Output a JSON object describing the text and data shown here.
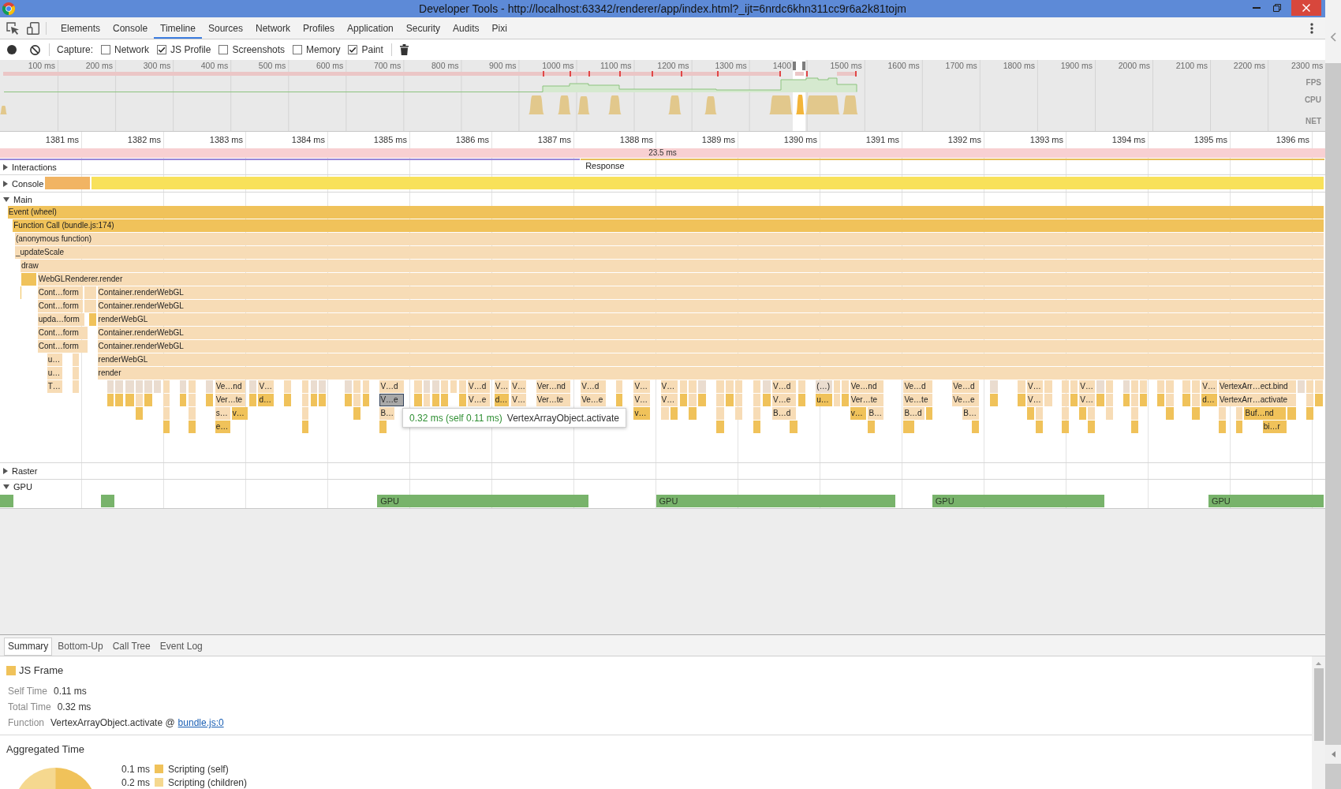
{
  "window": {
    "title": "Developer Tools - http://localhost:63342/renderer/app/index.html?_ijt=6nrdc6khn311cc9r6a2k81tojm"
  },
  "tabs": [
    {
      "label": "Elements",
      "selected": false
    },
    {
      "label": "Console",
      "selected": false
    },
    {
      "label": "Timeline",
      "selected": true
    },
    {
      "label": "Sources",
      "selected": false
    },
    {
      "label": "Network",
      "selected": false
    },
    {
      "label": "Profiles",
      "selected": false
    },
    {
      "label": "Application",
      "selected": false
    },
    {
      "label": "Security",
      "selected": false
    },
    {
      "label": "Audits",
      "selected": false
    },
    {
      "label": "Pixi",
      "selected": false
    }
  ],
  "toolbar": {
    "capture_label": "Capture:",
    "options": [
      {
        "label": "Network",
        "checked": false
      },
      {
        "label": "JS Profile",
        "checked": true
      },
      {
        "label": "Screenshots",
        "checked": false
      },
      {
        "label": "Memory",
        "checked": false
      },
      {
        "label": "Paint",
        "checked": true
      }
    ]
  },
  "overview": {
    "ticks": [
      "100 ms",
      "200 ms",
      "300 ms",
      "400 ms",
      "500 ms",
      "600 ms",
      "700 ms",
      "800 ms",
      "900 ms",
      "1000 ms",
      "1100 ms",
      "1200 ms",
      "1300 ms",
      "1400",
      "1500 ms",
      "1600 ms",
      "1700 ms",
      "1800 ms",
      "1900 ms",
      "2000 ms",
      "2100 ms",
      "2200 ms",
      "2300 ms"
    ],
    "lanes": [
      "FPS",
      "CPU",
      "NET"
    ]
  },
  "ruler": {
    "ticks": [
      "1381 ms",
      "1382 ms",
      "1383 ms",
      "1384 ms",
      "1385 ms",
      "1386 ms",
      "1387 ms",
      "1388 ms",
      "1389 ms",
      "1390 ms",
      "1391 ms",
      "1392 ms",
      "1393 ms",
      "1394 ms",
      "1395 ms",
      "1396 ms"
    ]
  },
  "frame": {
    "duration": "23.5 ms"
  },
  "tracks": [
    {
      "name": "Interactions",
      "kind": "interactions",
      "expanded": false,
      "rows": [
        {
          "blocks": [
            {
              "color": "#9a88d8",
              "selected": false
            },
            {
              "label": "Response",
              "color": "#e6bf5a",
              "selected": false
            }
          ]
        }
      ]
    },
    {
      "name": "Console",
      "kind": "console",
      "expanded": false,
      "rows": [
        {
          "blocks": [
            {
              "color": "#f1b463",
              "selected": false
            },
            {
              "color": "#f8e15a",
              "selected": false
            }
          ]
        }
      ]
    },
    {
      "name": "Main",
      "kind": "flame",
      "expanded": true,
      "rows": [
        {
          "blocks": [
            {
              "label": "Event (wheel)",
              "color": "#f0c25a",
              "selected": false
            }
          ]
        },
        {
          "blocks": [
            {
              "label": "Function Call (bundle.js:174)",
              "color": "#f0c25a",
              "selected": false
            }
          ]
        },
        {
          "blocks": [
            {
              "label": "(anonymous function)",
              "color": "#f7dcb6",
              "selected": false
            }
          ]
        },
        {
          "blocks": [
            {
              "label": "_updateScale",
              "color": "#f7dcb6",
              "selected": false
            }
          ]
        },
        {
          "blocks": [
            {
              "label": "draw",
              "color": "#f7dcb6",
              "selected": false
            }
          ]
        },
        {
          "blocks": [
            {
              "color": "#f0c25a",
              "selected": false
            },
            {
              "label": "WebGLRenderer.render",
              "color": "#f7dcb6",
              "selected": false
            }
          ]
        },
        {
          "blocks": [
            {
              "color": "#f0c25a",
              "selected": false
            },
            {
              "label": "Cont…form",
              "color": "#f7dcb6",
              "selected": false
            },
            {
              "color": "#f7dcb6",
              "selected": false
            },
            {
              "label": "Container.renderWebGL",
              "color": "#f7dcb6",
              "selected": false
            }
          ]
        },
        {
          "blocks": [
            {
              "label": "Cont…form",
              "color": "#f7dcb6",
              "selected": false
            },
            {
              "color": "#f7dcb6",
              "selected": false
            },
            {
              "label": "Container.renderWebGL",
              "color": "#f7dcb6",
              "selected": false
            }
          ]
        },
        {
          "blocks": [
            {
              "label": "upda…form",
              "color": "#f7dcb6",
              "selected": false
            },
            {
              "color": "#f0c25a",
              "selected": false
            },
            {
              "label": "renderWebGL",
              "color": "#f7dcb6",
              "selected": false
            }
          ]
        },
        {
          "blocks": [
            {
              "label": "Cont…form",
              "color": "#f7dcb6",
              "selected": false
            },
            {
              "label": "Container.renderWebGL",
              "color": "#f7dcb6",
              "selected": false
            }
          ]
        },
        {
          "blocks": [
            {
              "label": "Cont…form",
              "color": "#f7dcb6",
              "selected": false
            },
            {
              "label": "Container.renderWebGL",
              "color": "#f7dcb6",
              "selected": false
            }
          ]
        },
        {
          "blocks": [
            {
              "label": "u…",
              "color": "#f7dcb6",
              "selected": false
            },
            {
              "color": "#f7dcb6",
              "selected": false
            },
            {
              "label": "renderWebGL",
              "color": "#f7dcb6",
              "selected": false
            }
          ]
        },
        {
          "blocks": [
            {
              "label": "u…",
              "color": "#f7dcb6",
              "selected": false
            },
            {
              "color": "#f7dcb6",
              "selected": false
            },
            {
              "label": "render",
              "color": "#f7dcb6",
              "selected": false
            }
          ]
        },
        {
          "blocks": [
            {
              "label": "T…",
              "color": "#f7dcb6",
              "selected": false
            },
            {
              "color": "#f7dcb6",
              "selected": false
            },
            {
              "color": "#eadccf",
              "selected": false
            },
            {
              "color": "#eadccf",
              "selected": false
            },
            {
              "color": "#eadccf",
              "selected": false
            },
            {
              "color": "#eadccf",
              "selected": false
            },
            {
              "color": "#eadccf",
              "selected": false
            },
            {
              "color": "#eadccf",
              "selected": false
            },
            {
              "color": "#f7dcb6",
              "selected": false
            },
            {
              "color": "#eadccf",
              "selected": false
            },
            {
              "color": "#f7dcb6",
              "selected": false
            },
            {
              "color": "#eadccf",
              "selected": false
            },
            {
              "label": "Ve…nd",
              "color": "#f7dcb6",
              "selected": false
            },
            {
              "color": "#eadccf",
              "selected": false
            },
            {
              "label": "V…",
              "color": "#f7dcb6",
              "selected": false
            },
            {
              "color": "#f7dcb6",
              "selected": false
            },
            {
              "color": "#f7dcb6",
              "selected": false
            },
            {
              "color": "#eadccf",
              "selected": false
            },
            {
              "color": "#eadccf",
              "selected": false
            },
            {
              "color": "#eadccf",
              "selected": false
            },
            {
              "color": "#f7dcb6",
              "selected": false
            },
            {
              "color": "#f7dcb6",
              "selected": false
            },
            {
              "label": "V…d",
              "color": "#f7dcb6",
              "selected": false
            },
            {
              "color": "#f7dcb6",
              "selected": false
            },
            {
              "color": "#eadccf",
              "selected": false
            },
            {
              "color": "#eadccf",
              "selected": false
            },
            {
              "color": "#f7dcb6",
              "selected": false
            },
            {
              "color": "#f7dcb6",
              "selected": false
            },
            {
              "color": "#f7dcb6",
              "selected": false
            },
            {
              "label": "V…d",
              "color": "#f7dcb6",
              "selected": false
            },
            {
              "label": "V…",
              "color": "#f7dcb6",
              "selected": false
            },
            {
              "label": "V…",
              "color": "#f7dcb6",
              "selected": false
            },
            {
              "label": "Ver…nd",
              "color": "#f7dcb6",
              "selected": false
            },
            {
              "label": "V…d",
              "color": "#f7dcb6",
              "selected": false
            },
            {
              "color": "#f7dcb6",
              "selected": false
            },
            {
              "label": "V…",
              "color": "#f7dcb6",
              "selected": false
            },
            {
              "label": "V…",
              "color": "#f7dcb6",
              "selected": false
            },
            {
              "color": "#f7dcb6",
              "selected": false
            },
            {
              "color": "#f7dcb6",
              "selected": false
            },
            {
              "color": "#eadccf",
              "selected": false
            },
            {
              "color": "#f7dcb6",
              "selected": false
            },
            {
              "color": "#f7dcb6",
              "selected": false
            },
            {
              "color": "#f7dcb6",
              "selected": false
            },
            {
              "color": "#f7dcb6",
              "selected": false
            },
            {
              "color": "#eadccf",
              "selected": false
            },
            {
              "label": "V…d",
              "color": "#f7dcb6",
              "selected": false
            },
            {
              "color": "#f7dcb6",
              "selected": false
            },
            {
              "label": "(…)",
              "color": "#eadccf",
              "selected": false
            },
            {
              "color": "#f7dcb6",
              "selected": false
            },
            {
              "color": "#f7dcb6",
              "selected": false
            },
            {
              "label": "Ve…nd",
              "color": "#f7dcb6",
              "selected": false
            },
            {
              "label": "Ve…d",
              "color": "#f7dcb6",
              "selected": false
            },
            {
              "label": "Ve…d",
              "color": "#f7dcb6",
              "selected": false
            },
            {
              "color": "#eadccf",
              "selected": false
            },
            {
              "color": "#f7dcb6",
              "selected": false
            },
            {
              "label": "V…",
              "color": "#f7dcb6",
              "selected": false
            },
            {
              "color": "#f7dcb6",
              "selected": false
            },
            {
              "color": "#f7dcb6",
              "selected": false
            },
            {
              "color": "#f7dcb6",
              "selected": false
            },
            {
              "label": "V…",
              "color": "#f7dcb6",
              "selected": false
            },
            {
              "color": "#eadccf",
              "selected": false
            },
            {
              "color": "#f7dcb6",
              "selected": false
            },
            {
              "color": "#eadccf",
              "selected": false
            },
            {
              "color": "#f7dcb6",
              "selected": false
            },
            {
              "color": "#f7dcb6",
              "selected": false
            },
            {
              "color": "#f7dcb6",
              "selected": false
            },
            {
              "color": "#f7dcb6",
              "selected": false
            },
            {
              "color": "#f7dcb6",
              "selected": false
            },
            {
              "color": "#f7dcb6",
              "selected": false
            },
            {
              "label": "V…",
              "color": "#f7dcb6",
              "selected": false
            },
            {
              "label": "VertexArr…ect.bind",
              "color": "#f7dcb6",
              "selected": false
            },
            {
              "color": "#eadccf",
              "selected": false
            },
            {
              "color": "#f7dcb6",
              "selected": false
            },
            {
              "color": "#f7dcb6",
              "selected": false
            }
          ]
        },
        {
          "blocks": [
            {
              "color": "#f0c25a",
              "selected": false
            },
            {
              "color": "#f0c25a",
              "selected": false
            },
            {
              "color": "#f0c25a",
              "selected": false
            },
            {
              "color": "#f7dcb6",
              "selected": false
            },
            {
              "color": "#f0c25a",
              "selected": false
            },
            {
              "color": "#f7dcb6",
              "selected": false
            },
            {
              "color": "#f0c25a",
              "selected": false
            },
            {
              "color": "#f7dcb6",
              "selected": false
            },
            {
              "color": "#f0c25a",
              "selected": false
            },
            {
              "label": "Ver…te",
              "color": "#f7dcb6",
              "selected": false
            },
            {
              "color": "#f0c25a",
              "selected": false
            },
            {
              "label": "d…",
              "color": "#f0c25a",
              "selected": false
            },
            {
              "color": "#f0c25a",
              "selected": false
            },
            {
              "color": "#f7dcb6",
              "selected": false
            },
            {
              "color": "#f0c25a",
              "selected": false
            },
            {
              "color": "#f0c25a",
              "selected": false
            },
            {
              "color": "#f0c25a",
              "selected": false
            },
            {
              "color": "#f7dcb6",
              "selected": false
            },
            {
              "color": "#f0c25a",
              "selected": false
            },
            {
              "label": "V…e",
              "selected": true
            },
            {
              "color": "#f0c25a",
              "selected": false
            },
            {
              "color": "#f7dcb6",
              "selected": false
            },
            {
              "color": "#f0c25a",
              "selected": false
            },
            {
              "color": "#f0c25a",
              "selected": false
            },
            {
              "color": "#f0c25a",
              "selected": false
            },
            {
              "label": "V…e",
              "color": "#f7dcb6",
              "selected": false
            },
            {
              "label": "d…",
              "color": "#f0c25a",
              "selected": false
            },
            {
              "label": "V…",
              "color": "#f7dcb6",
              "selected": false
            },
            {
              "label": "Ver…te",
              "color": "#f7dcb6",
              "selected": false
            },
            {
              "label": "Ve…e",
              "color": "#f7dcb6",
              "selected": false
            },
            {
              "color": "#f0c25a",
              "selected": false
            },
            {
              "label": "V…",
              "color": "#f7dcb6",
              "selected": false
            },
            {
              "label": "V…",
              "color": "#f7dcb6",
              "selected": false
            },
            {
              "color": "#f0c25a",
              "selected": false
            },
            {
              "color": "#f7dcb6",
              "selected": false
            },
            {
              "color": "#f0c25a",
              "selected": false
            },
            {
              "color": "#f7dcb6",
              "selected": false
            },
            {
              "color": "#f0c25a",
              "selected": false
            },
            {
              "color": "#f7dcb6",
              "selected": false
            },
            {
              "color": "#f7dcb6",
              "selected": false
            },
            {
              "color": "#f0c25a",
              "selected": false
            },
            {
              "label": "V…e",
              "color": "#f7dcb6",
              "selected": false
            },
            {
              "color": "#f0c25a",
              "selected": false
            },
            {
              "label": "u…",
              "color": "#f0c25a",
              "selected": false
            },
            {
              "color": "#f7dcb6",
              "selected": false
            },
            {
              "color": "#f0c25a",
              "selected": false
            },
            {
              "label": "Ver…te",
              "color": "#f7dcb6",
              "selected": false
            },
            {
              "label": "Ve…te",
              "color": "#f7dcb6",
              "selected": false
            },
            {
              "label": "Ve…e",
              "color": "#f7dcb6",
              "selected": false
            },
            {
              "color": "#f0c25a",
              "selected": false
            },
            {
              "color": "#f0c25a",
              "selected": false
            },
            {
              "label": "V…",
              "color": "#f7dcb6",
              "selected": false
            },
            {
              "color": "#f7dcb6",
              "selected": false
            },
            {
              "color": "#f7dcb6",
              "selected": false
            },
            {
              "color": "#f0c25a",
              "selected": false
            },
            {
              "label": "V…",
              "color": "#f7dcb6",
              "selected": false
            },
            {
              "color": "#f0c25a",
              "selected": false
            },
            {
              "color": "#f7dcb6",
              "selected": false
            },
            {
              "color": "#f0c25a",
              "selected": false
            },
            {
              "color": "#f7dcb6",
              "selected": false
            },
            {
              "color": "#f0c25a",
              "selected": false
            },
            {
              "color": "#f0c25a",
              "selected": false
            },
            {
              "color": "#f7dcb6",
              "selected": false
            },
            {
              "color": "#f0c25a",
              "selected": false
            },
            {
              "color": "#f7dcb6",
              "selected": false
            },
            {
              "label": "d…",
              "color": "#f0c25a",
              "selected": false
            },
            {
              "label": "VertexArr…activate",
              "color": "#f7dcb6",
              "selected": false
            },
            {
              "color": "#f7dcb6",
              "selected": false
            },
            {
              "color": "#f0c25a",
              "selected": false
            }
          ]
        },
        {
          "blocks": [
            {
              "color": "#f0c25a",
              "selected": false
            },
            {
              "color": "#f7dcb6",
              "selected": false
            },
            {
              "color": "#f7dcb6",
              "selected": false
            },
            {
              "label": "s…",
              "color": "#f7dcb6",
              "selected": false
            },
            {
              "label": "v…",
              "color": "#f0c25a",
              "selected": false
            },
            {
              "color": "#f7dcb6",
              "selected": false
            },
            {
              "color": "#f0c25a",
              "selected": false
            },
            {
              "label": "B…",
              "color": "#f7dcb6",
              "selected": false
            },
            {
              "label": "v…",
              "color": "#f0c25a",
              "selected": false
            },
            {
              "color": "#f7dcb6",
              "selected": false
            },
            {
              "color": "#f0c25a",
              "selected": false
            },
            {
              "color": "#f0c25a",
              "selected": false
            },
            {
              "color": "#f7dcb6",
              "selected": false
            },
            {
              "color": "#f7dcb6",
              "selected": false
            },
            {
              "color": "#f7dcb6",
              "selected": false
            },
            {
              "label": "B…d",
              "color": "#f7dcb6",
              "selected": false
            },
            {
              "label": "v…",
              "color": "#f0c25a",
              "selected": false
            },
            {
              "label": "B…",
              "color": "#f7dcb6",
              "selected": false
            },
            {
              "label": "B…d",
              "color": "#f7dcb6",
              "selected": false
            },
            {
              "color": "#f0c25a",
              "selected": false
            },
            {
              "label": "B…",
              "color": "#f7dcb6",
              "selected": false
            },
            {
              "color": "#f0c25a",
              "selected": false
            },
            {
              "color": "#f7dcb6",
              "selected": false
            },
            {
              "color": "#f7dcb6",
              "selected": false
            },
            {
              "color": "#f0c25a",
              "selected": false
            },
            {
              "color": "#f7dcb6",
              "selected": false
            },
            {
              "color": "#f7dcb6",
              "selected": false
            },
            {
              "color": "#f7dcb6",
              "selected": false
            },
            {
              "color": "#f0c25a",
              "selected": false
            },
            {
              "color": "#f0c25a",
              "selected": false
            },
            {
              "color": "#f7dcb6",
              "selected": false
            },
            {
              "color": "#f7dcb6",
              "selected": false
            },
            {
              "label": "Buf…nd",
              "color": "#f0c25a",
              "selected": false
            },
            {
              "color": "#f0c25a",
              "selected": false
            },
            {
              "color": "#f0c25a",
              "selected": false
            }
          ]
        },
        {
          "blocks": [
            {
              "color": "#f0c25a",
              "selected": false
            },
            {
              "color": "#f0c25a",
              "selected": false
            },
            {
              "label": "e…",
              "color": "#f0c25a",
              "selected": false
            },
            {
              "color": "#f0c25a",
              "selected": false
            },
            {
              "color": "#f0c25a",
              "selected": false
            },
            {
              "color": "#f0c25a",
              "selected": false
            },
            {
              "color": "#f0c25a",
              "selected": false
            },
            {
              "color": "#f0c25a",
              "selected": false
            },
            {
              "color": "#f0c25a",
              "selected": false
            },
            {
              "color": "#f0c25a",
              "selected": false
            },
            {
              "color": "#f0c25a",
              "selected": false
            },
            {
              "color": "#f0c25a",
              "selected": false
            },
            {
              "color": "#f0c25a",
              "selected": false
            },
            {
              "color": "#f0c25a",
              "selected": false
            },
            {
              "color": "#f0c25a",
              "selected": false
            },
            {
              "color": "#f0c25a",
              "selected": false
            },
            {
              "color": "#f0c25a",
              "selected": false
            },
            {
              "label": "bi…r",
              "color": "#f0c25a",
              "selected": false
            }
          ]
        }
      ],
      "tooltip": {
        "time": "0.32 ms (self 0.11 ms)",
        "name": "VertexArrayObject.activate"
      }
    },
    {
      "name": "Raster",
      "kind": "raster",
      "expanded": false
    },
    {
      "name": "GPU",
      "kind": "gpu",
      "expanded": true,
      "rows": [
        {
          "blocks": [
            {
              "selected": false
            },
            {
              "selected": false
            },
            {
              "label": "GPU",
              "selected": false
            },
            {
              "label": "GPU",
              "selected": false
            },
            {
              "label": "GPU",
              "selected": false
            },
            {
              "label": "GPU",
              "selected": false
            }
          ]
        }
      ]
    }
  ],
  "details": {
    "tabs": [
      {
        "label": "Summary",
        "selected": true
      },
      {
        "label": "Bottom-Up",
        "selected": false
      },
      {
        "label": "Call Tree",
        "selected": false
      },
      {
        "label": "Event Log",
        "selected": false
      }
    ],
    "category": {
      "label": "JS Frame",
      "color": "#f0c25a"
    },
    "fields": [
      {
        "label": "Self Time",
        "value": "0.11 ms"
      },
      {
        "label": "Total Time",
        "value": "0.32 ms"
      },
      {
        "label": "Function",
        "value": "VertexArrayObject.activate @",
        "link": "bundle.js:0"
      }
    ],
    "aggregated": {
      "title": "Aggregated Time",
      "legend": [
        {
          "value": "0.1 ms",
          "label": "Scripting (self)",
          "color": "#f0c25a"
        },
        {
          "value": "0.2 ms",
          "label": "Scripting (children)",
          "color": "#f5d88f"
        }
      ]
    }
  }
}
